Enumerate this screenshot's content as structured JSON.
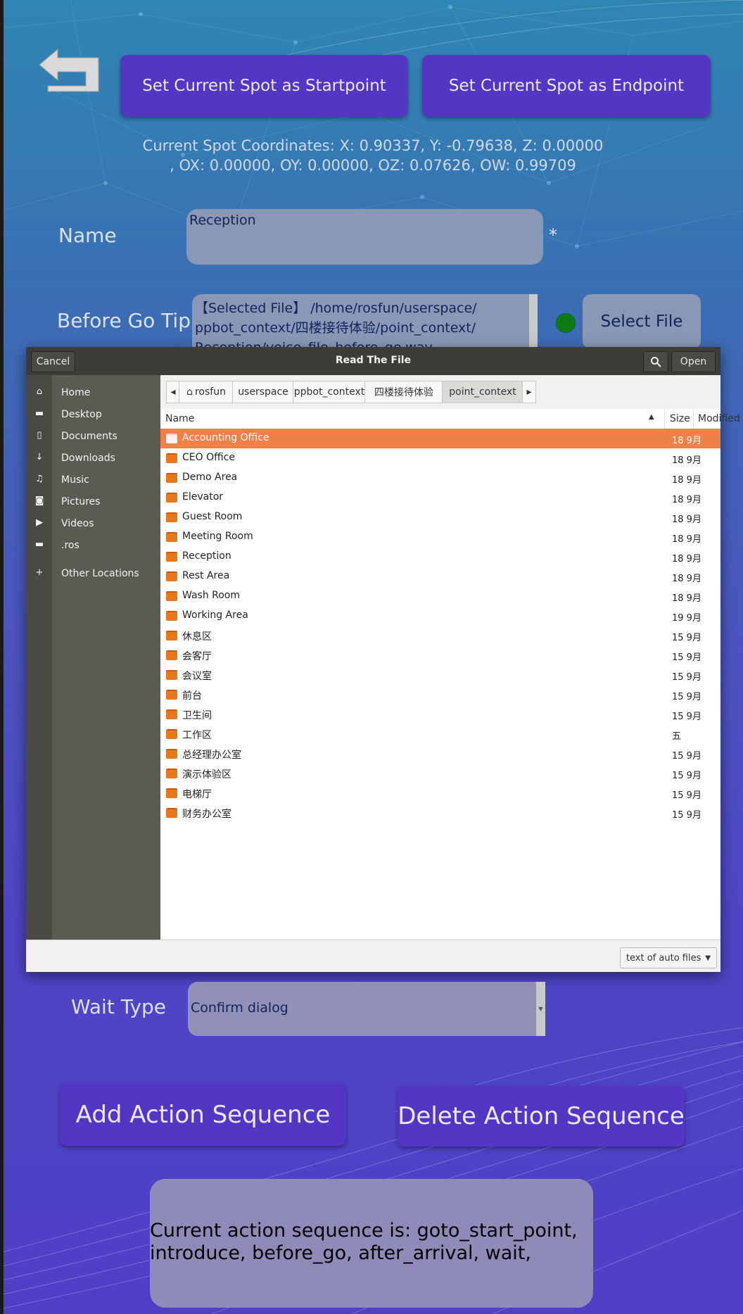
{
  "header": {
    "set_start_label": "Set Current Spot as Startpoint",
    "set_end_label": "Set Current Spot as Endpoint"
  },
  "coordinates": {
    "line1": "Current Spot Coordinates: X: 0.90337, Y: -0.79638, Z: 0.00000",
    "line2": ", OX: 0.00000, OY: 0.00000, OZ: 0.07626, OW: 0.99709"
  },
  "form": {
    "name_label": "Name",
    "name_value": "Reception",
    "required_mark": "*",
    "before_go_label": "Before Go Tip",
    "before_go_text_line1": "【Selected File】 /home/rosfun/userspace/",
    "before_go_text_line2": "ppbot_context/四楼接待体验/point_context/",
    "before_go_text_line3": "Reception/voice_file_before_go.wav",
    "select_file_label": "Select File",
    "status_color": "#0d7a12",
    "wait_type_label": "Wait Type",
    "wait_type_value": "Confirm dialog"
  },
  "dialog": {
    "title": "Read The File",
    "cancel_label": "Cancel",
    "open_label": "Open",
    "places": [
      {
        "icon": "home-icon",
        "label": "Home"
      },
      {
        "icon": "folder-icon",
        "label": "Desktop"
      },
      {
        "icon": "document-icon",
        "label": "Documents"
      },
      {
        "icon": "download-icon",
        "label": "Downloads"
      },
      {
        "icon": "music-icon",
        "label": "Music"
      },
      {
        "icon": "camera-icon",
        "label": "Pictures"
      },
      {
        "icon": "video-icon",
        "label": "Videos"
      },
      {
        "icon": "folder-icon",
        "label": ".ros"
      },
      {
        "icon": "plus-icon",
        "label": "Other Locations"
      }
    ],
    "breadcrumbs": [
      "rosfun",
      "userspace",
      "ppbot_context",
      "四楼接待体验",
      "point_context"
    ],
    "columns": {
      "name": "Name",
      "size": "Size",
      "modified": "Modified"
    },
    "files": [
      {
        "name": "Accounting Office",
        "modified": "18 9月"
      },
      {
        "name": "CEO Office",
        "modified": "18 9月"
      },
      {
        "name": "Demo Area",
        "modified": "18 9月"
      },
      {
        "name": "Elevator",
        "modified": "18 9月"
      },
      {
        "name": "Guest Room",
        "modified": "18 9月"
      },
      {
        "name": "Meeting Room",
        "modified": "18 9月"
      },
      {
        "name": "Reception",
        "modified": "18 9月"
      },
      {
        "name": "Rest Area",
        "modified": "18 9月"
      },
      {
        "name": "Wash Room",
        "modified": "18 9月"
      },
      {
        "name": "Working Area",
        "modified": "19 9月"
      },
      {
        "name": "休息区",
        "modified": "15 9月"
      },
      {
        "name": "会客厅",
        "modified": "15 9月"
      },
      {
        "name": "会议室",
        "modified": "15 9月"
      },
      {
        "name": "前台",
        "modified": "15 9月"
      },
      {
        "name": "卫生间",
        "modified": "15 9月"
      },
      {
        "name": "工作区",
        "modified": "五"
      },
      {
        "name": "总经理办公室",
        "modified": "15 9月"
      },
      {
        "name": "演示体验区",
        "modified": "15 9月"
      },
      {
        "name": "电梯厅",
        "modified": "15 9月"
      },
      {
        "name": "财务办公室",
        "modified": "15 9月"
      }
    ],
    "filter_label": "text of auto files"
  },
  "actions": {
    "add_label": "Add Action Sequence",
    "delete_label": "Delete Action Sequence"
  },
  "sequence": {
    "line1": "Current action sequence is: goto_start_point,",
    "line2": "introduce, before_go, after_arrival, wait,"
  }
}
